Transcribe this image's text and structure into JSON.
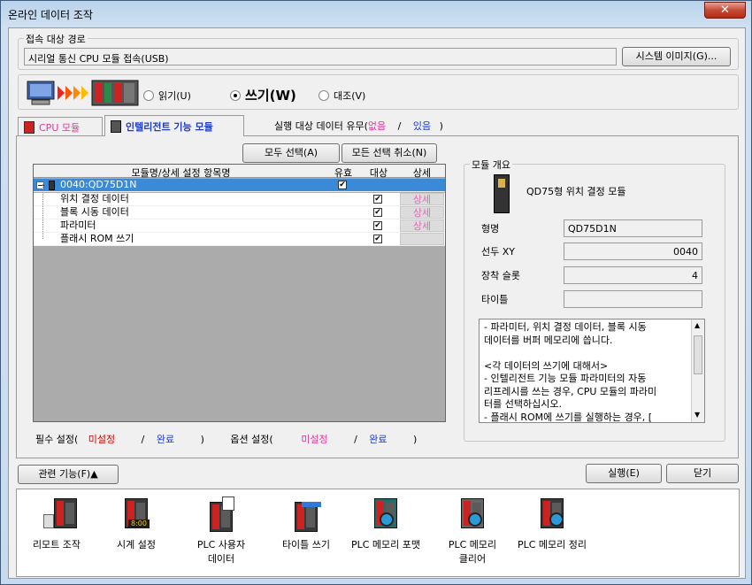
{
  "window": {
    "title": "온라인 데이터 조작",
    "close": "✕"
  },
  "connection": {
    "legend": "접속 대상 경로",
    "path": "시리얼 통신 CPU 모듈 접속(USB)",
    "system_image_button": "시스템 이미지(G)..."
  },
  "mode": {
    "read": "읽기(U)",
    "write": "쓰기(W)",
    "verify": "대조(V)",
    "selected": "write"
  },
  "tabs": {
    "cpu": "CPU 모듈",
    "intelligent": "인텔리전트 기능 모듈",
    "exist_label": "실행 대상 데이터 유무(",
    "exist_none": "없음",
    "exist_sep": "/",
    "exist_yes": "있음",
    "exist_end": ")"
  },
  "buttons": {
    "select_all": "모두 선택(A)",
    "deselect_all": "모든 선택 취소(N)",
    "related": "관련 기능(F)▲",
    "execute": "실행(E)",
    "close": "닫기"
  },
  "grid": {
    "headers": [
      "모듈명/상세 설정 항목명",
      "유효",
      "대상",
      "상세"
    ],
    "module_row": {
      "expander": "−",
      "label": "0040:QD75D1N",
      "valid": true
    },
    "rows": [
      {
        "label": "위치 결정 데이터",
        "target": true,
        "detail": "상세"
      },
      {
        "label": "블록 시동 데이터",
        "target": true,
        "detail": "상세"
      },
      {
        "label": "파라미터",
        "target": true,
        "detail": "상세"
      },
      {
        "label": "플래시 ROM 쓰기",
        "target": true,
        "detail": ""
      }
    ]
  },
  "legend_line": {
    "required": "필수 설정(",
    "not_set": "미설정",
    "sep": "/",
    "done": "완료",
    "close": ")",
    "option": "옵션 설정(",
    "not_set2": "미설정",
    "sep2": "/",
    "done2": "완료",
    "close2": ")"
  },
  "summary": {
    "legend": "모듈 개요",
    "module_name": "QD75형 위치 결정 모듈",
    "model_label": "형명",
    "model": "QD75D1N",
    "head_xy_label": "선두 XY",
    "head_xy": "0040",
    "slot_label": "장착 슬롯",
    "slot": "4",
    "title_label": "타이틀",
    "title": "",
    "description": [
      "-  파라미터, 위치 결정 데이터, 블록 시동",
      "데이터를 버퍼 메모리에 씁니다.",
      "",
      "<각 데이터의 쓰기에 대해서>",
      "-  인텔리전트 기능 모듈 파라미터의 자동",
      "리프레시를 쓰는 경우, CPU 모듈의 파라미",
      "터를 선택하십시오.",
      "-  플래시 ROM에 쓰기를 실행하는 경우, ["
    ]
  },
  "tools": [
    {
      "label": "리모트 조작",
      "icon": "remote-operation-icon"
    },
    {
      "label": "시계 설정",
      "icon": "clock-setting-icon",
      "display": "8:00"
    },
    {
      "label": "PLC 사용자 데이터",
      "label2": "데이터",
      "label1": "PLC 사용자",
      "icon": "plc-user-data-icon"
    },
    {
      "label": "타이틀 쓰기",
      "icon": "title-write-icon"
    },
    {
      "label": "PLC 메모리 포맷",
      "icon": "plc-memory-format-icon"
    },
    {
      "label1": "PLC 메모리",
      "label2": "클리어",
      "icon": "plc-memory-clear-icon"
    },
    {
      "label": "PLC 메모리 정리",
      "icon": "plc-memory-arrange-icon"
    }
  ],
  "colors": {
    "pink": "#e0389a",
    "blue": "#1f3cc8",
    "red": "#d00000",
    "selection": "#3b8ad8"
  }
}
